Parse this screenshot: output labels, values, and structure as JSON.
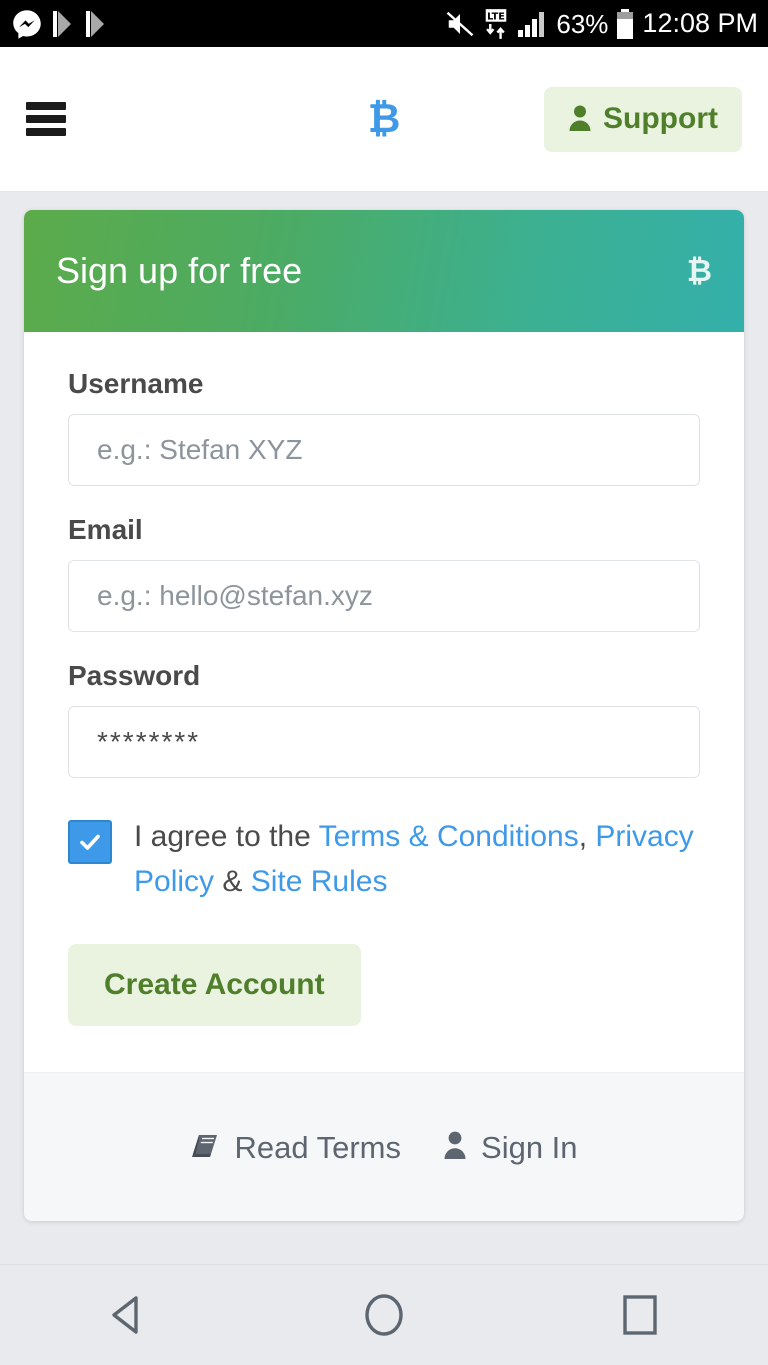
{
  "status_bar": {
    "app_icons": [
      "messenger-icon",
      "flag-icon",
      "flag-icon"
    ],
    "mute_icon": "mute-icon",
    "network_icon": "lte-icon",
    "signal_icon": "signal-bars-icon",
    "battery_percent": "63%",
    "battery_icon": "battery-icon",
    "clock": "12:08 PM"
  },
  "header": {
    "menu_icon": "hamburger-menu-icon",
    "brand_logo": "₿",
    "support_label": "Support",
    "support_icon": "person-icon",
    "support_bg": "#eaf3e0",
    "support_text_color": "#4f7f2b",
    "brand_color": "#3e9ae8"
  },
  "card": {
    "title": "Sign up for free",
    "header_logo": "₿",
    "gradient_start": "#5cab4a",
    "gradient_end": "#34b0ab",
    "fields": [
      {
        "label": "Username",
        "placeholder": "e.g.: Stefan XYZ",
        "value": ""
      },
      {
        "label": "Email",
        "placeholder": "e.g.: hello@stefan.xyz",
        "value": ""
      },
      {
        "label": "Password",
        "placeholder": "",
        "value": "********"
      }
    ],
    "terms": {
      "checked": true,
      "checkbox_color": "#3e9ae8",
      "intro": "I agree to the ",
      "link1": "Terms & Conditions",
      "sep1": ", ",
      "link2": "Privacy Policy",
      "sep2": " & ",
      "link3": "Site Rules",
      "link_color": "#3e9ae8"
    },
    "submit_label": "Create Account",
    "footer_links": [
      {
        "label": "Read Terms",
        "icon": "book-icon"
      },
      {
        "label": "Sign In",
        "icon": "person-icon"
      }
    ]
  },
  "nav_bar": {
    "back": "back-triangle-icon",
    "home": "home-circle-icon",
    "recents": "recents-square-icon"
  }
}
